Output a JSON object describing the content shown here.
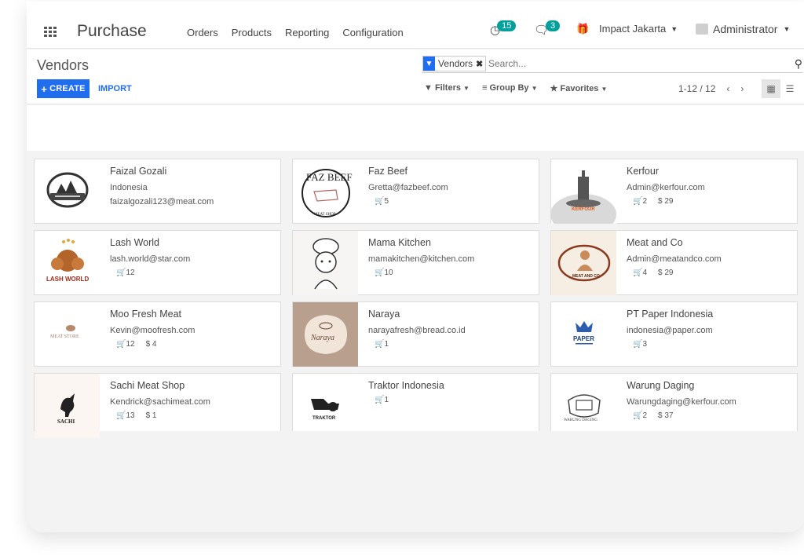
{
  "app": {
    "title": "Purchase",
    "menu": [
      "Orders",
      "Products",
      "Reporting",
      "Configuration"
    ],
    "activity_count": "15",
    "message_count": "3",
    "company": "Impact Jakarta",
    "user": "Administrator"
  },
  "breadcrumb": "Vendors",
  "buttons": {
    "create": "CREATE",
    "import": "IMPORT"
  },
  "search": {
    "facet": "Vendors",
    "placeholder": "Search..."
  },
  "options": {
    "filters": "Filters",
    "group_by": "Group By",
    "favorites": "Favorites"
  },
  "pager": "1-12 / 12",
  "vendors": [
    {
      "name": "Faizal Gozali",
      "line1": "Indonesia",
      "line2": "faizalgozali123@meat.com",
      "orders": "",
      "amount": ""
    },
    {
      "name": "Faz Beef",
      "line1": "Gretta@fazbeef.com",
      "line2": "",
      "orders": "5",
      "amount": ""
    },
    {
      "name": "Kerfour",
      "line1": "Admin@kerfour.com",
      "line2": "",
      "orders": "2",
      "amount": "$ 29"
    },
    {
      "name": "Lash World",
      "line1": "lash.world@star.com",
      "line2": "",
      "orders": "12",
      "amount": ""
    },
    {
      "name": "Mama Kitchen",
      "line1": "mamakitchen@kitchen.com",
      "line2": "",
      "orders": "10",
      "amount": ""
    },
    {
      "name": "Meat and Co",
      "line1": "Admin@meatandco.com",
      "line2": "",
      "orders": "4",
      "amount": "$ 29"
    },
    {
      "name": "Moo Fresh Meat",
      "line1": "Kevin@moofresh.com",
      "line2": "",
      "orders": "12",
      "amount": "$ 4"
    },
    {
      "name": "Naraya",
      "line1": "narayafresh@bread.co.id",
      "line2": "",
      "orders": "1",
      "amount": ""
    },
    {
      "name": "PT Paper Indonesia",
      "line1": "indonesia@paper.com",
      "line2": "",
      "orders": "3",
      "amount": ""
    },
    {
      "name": "Sachi Meat Shop",
      "line1": "Kendrick@sachimeat.com",
      "line2": "",
      "orders": "13",
      "amount": "$ 1"
    },
    {
      "name": "Traktor Indonesia",
      "line1": "",
      "line2": "",
      "orders": "1",
      "amount": ""
    },
    {
      "name": "Warung Daging",
      "line1": "Warungdaging@kerfour.com",
      "line2": "",
      "orders": "2",
      "amount": "$ 37"
    }
  ],
  "logos": [
    "FAZ BEEF",
    "MEAT SHOP",
    "KERFOUR",
    "LASH WORLD",
    "MEAT AND CO",
    "MEAT STORE",
    "Naraya",
    "PAPER",
    "SACHI",
    "TRAKTOR",
    "WARUNG DAGING"
  ],
  "colors": {
    "accent": "#1f6ef0",
    "badge": "#00a09d"
  }
}
